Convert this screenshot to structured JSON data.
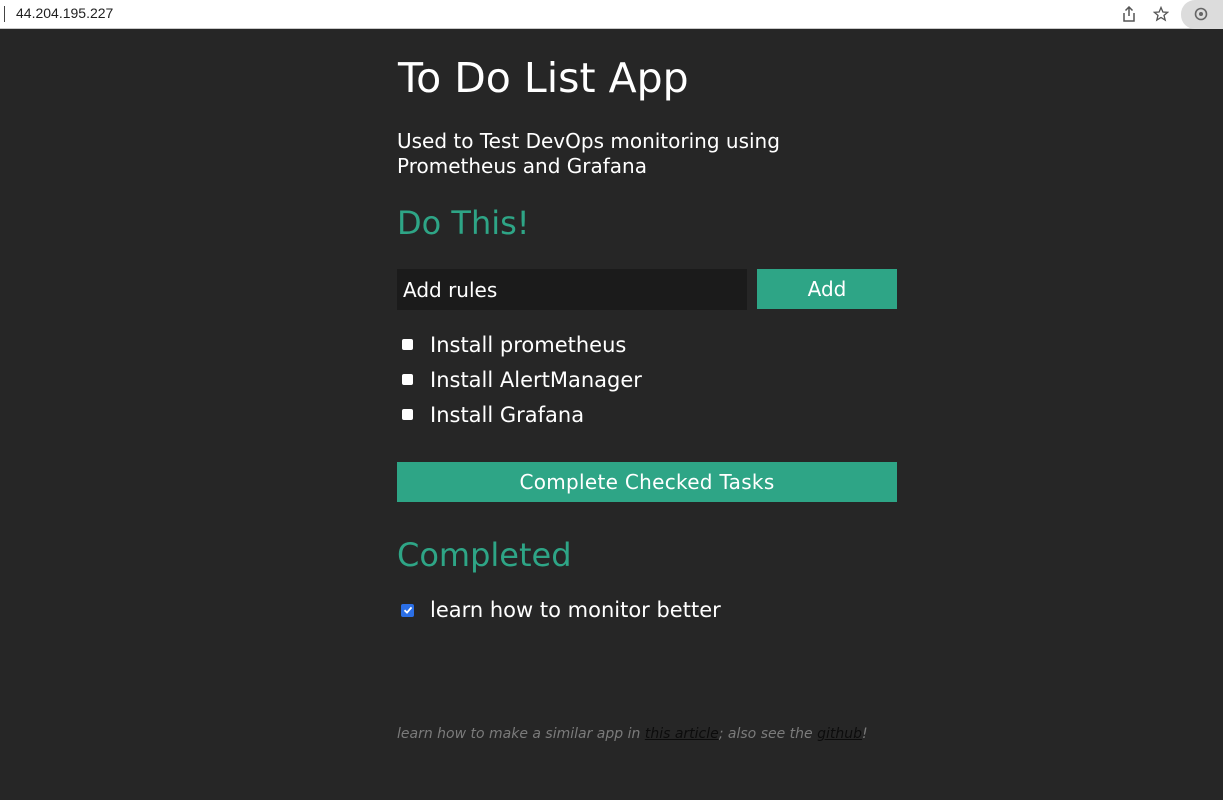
{
  "browser": {
    "url": "44.204.195.227",
    "icons": [
      "share-icon",
      "star-icon",
      "extension-icon"
    ]
  },
  "app": {
    "title": "To Do List App",
    "subtitle": "Used to Test DevOps monitoring using Prometheus and Grafana"
  },
  "todo": {
    "heading": "Do This!",
    "input_value": "Add rules",
    "add_label": "Add",
    "tasks": [
      {
        "label": "Install prometheus",
        "checked": false
      },
      {
        "label": "Install AlertManager",
        "checked": false
      },
      {
        "label": "Install Grafana",
        "checked": false
      }
    ],
    "complete_label": "Complete Checked Tasks"
  },
  "completed": {
    "heading": "Completed",
    "items": [
      {
        "label": "learn how to monitor better",
        "checked": true
      }
    ]
  },
  "footer": {
    "text_before": "learn how to make a similar app in ",
    "article_link": "this article",
    "text_middle": "; also see the ",
    "github_link": "github",
    "text_after": "!"
  },
  "colors": {
    "accent": "#2ea586",
    "background": "#262626",
    "checkbox_checked": "#2b6fe6"
  }
}
